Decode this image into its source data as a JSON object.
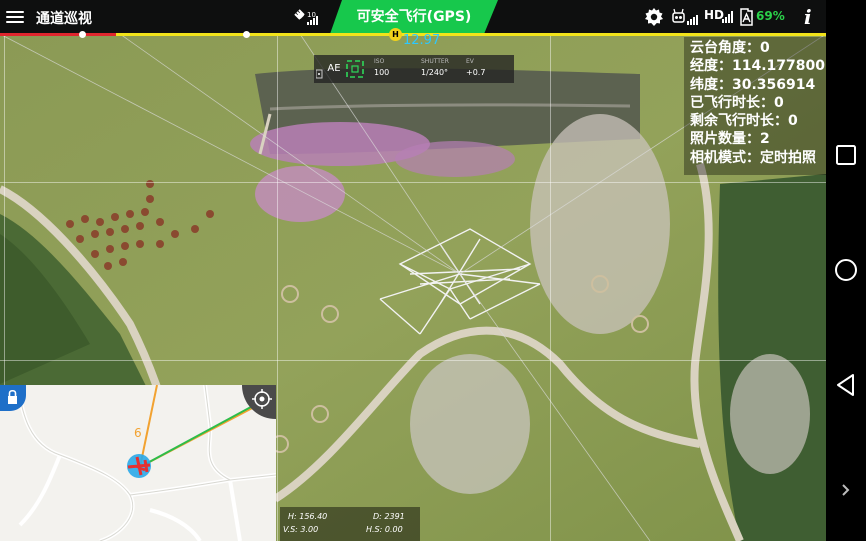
{
  "topbar": {
    "mission_title": "通道巡视",
    "gps_signal_value": "10",
    "flight_status": "可安全飞行(GPS)",
    "hd_label": "HD",
    "battery_level": "69%",
    "info_label": "i"
  },
  "route": {
    "home_marker_label": "H",
    "home_distance": "12.97",
    "progress_done_fraction": 0.14
  },
  "exposure": {
    "mode_label": "AE",
    "iso_label": "ISO",
    "iso_value": "100",
    "shutter_label": "SHUTTER",
    "shutter_value": "1/240°",
    "ev_label": "EV",
    "ev_value": "+0.7"
  },
  "telemetry": {
    "gimbal_angle": "云台角度：0",
    "longitude": "经度：114.177800",
    "latitude": "纬度：30.356914",
    "flight_time": "已飞行时长：0",
    "remaining_time": "剩余飞行时长：0",
    "photo_count": "照片数量：2",
    "camera_mode": "相机模式：定时拍照"
  },
  "map": {
    "route_label": "6"
  },
  "flight_data": {
    "altitude": "H: 156.40",
    "distance": "D: 2391",
    "vertical_speed": "V.S: 3.00",
    "horizontal_speed": "H.S: 0.00"
  },
  "colors": {
    "status_green": "#17c84c",
    "progress_red": "#e0262e",
    "progress_yellow": "#f2e41a",
    "home_distance_blue": "#2cc8ff",
    "battery_green": "#2bd24a"
  }
}
